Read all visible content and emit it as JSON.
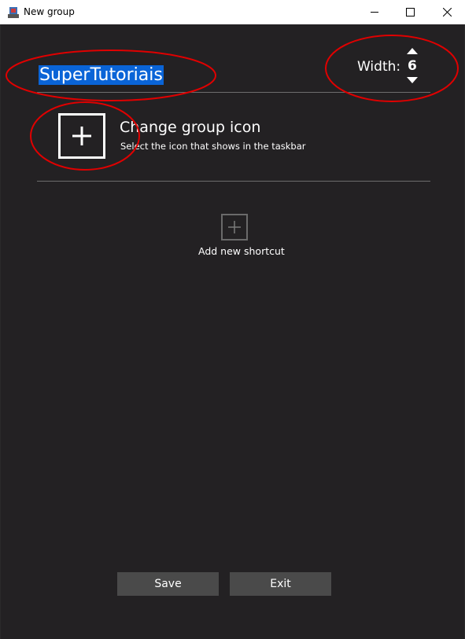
{
  "window": {
    "title": "New group"
  },
  "group": {
    "name": "SuperTutoriais",
    "width_label": "Width:",
    "width_value": "6"
  },
  "group_icon": {
    "title": "Change group icon",
    "subtitle": "Select the icon that shows in the taskbar"
  },
  "shortcuts": {
    "add_label": "Add new shortcut"
  },
  "footer": {
    "save_label": "Save",
    "exit_label": "Exit"
  },
  "colors": {
    "background": "#232123",
    "selection": "#0a64d7",
    "button": "#4a4a4a",
    "annotation": "#e00000"
  }
}
